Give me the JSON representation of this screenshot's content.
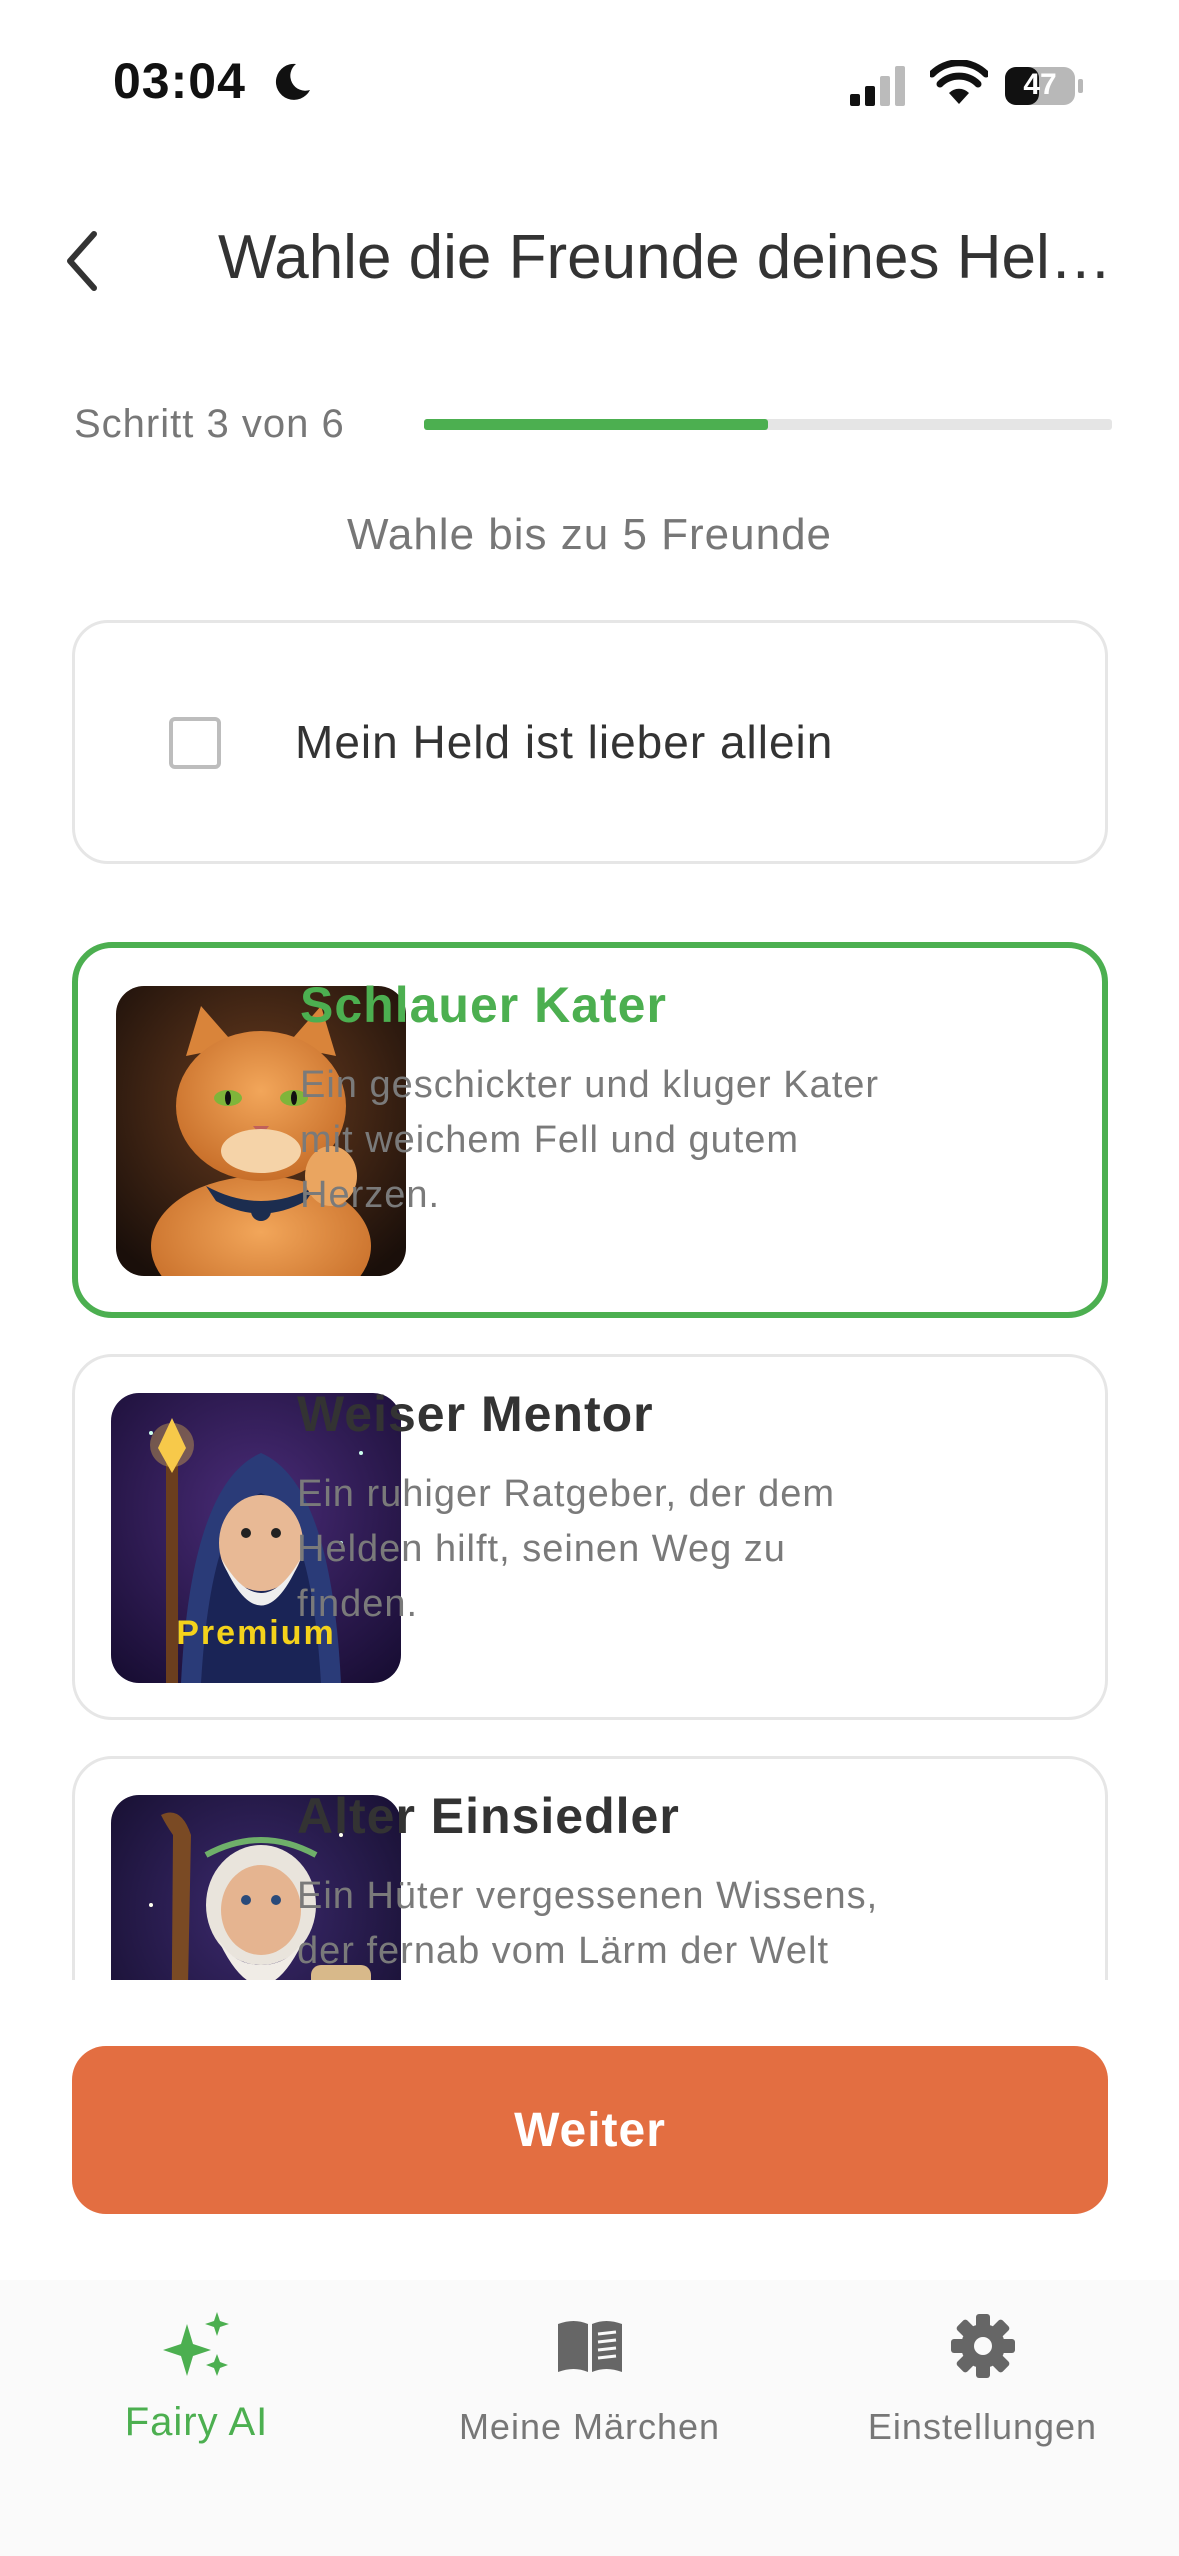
{
  "status_bar": {
    "time": "03:04",
    "battery": "47"
  },
  "header": {
    "title": "Wahle die Freunde deines Held..."
  },
  "progress": {
    "step_label": "Schritt 3 von 6",
    "current": 3,
    "total": 6,
    "fraction": 0.5
  },
  "subtitle": "Wahle bis zu 5 Freunde",
  "alone_option": {
    "label": "Mein Held ist lieber allein",
    "checked": false
  },
  "friends": [
    {
      "title": "Schlauer Kater",
      "desc_lines": [
        "Ein geschickter und kluger Kater",
        "mit weichem Fell und gutem",
        "Herzen."
      ],
      "selected": true,
      "badge": ""
    },
    {
      "title": "Weiser Mentor",
      "desc_lines": [
        "Ein ruhiger Ratgeber, der dem",
        "Helden hilft, seinen Weg zu",
        "finden."
      ],
      "selected": false,
      "badge": "Premium"
    },
    {
      "title": "Alter Einsiedler",
      "desc_lines": [
        "Ein Hüter vergessenen Wissens,",
        "der fernab vom Lärm der Welt"
      ],
      "selected": false,
      "badge": ""
    }
  ],
  "next_button": {
    "label": "Weiter"
  },
  "tabs": [
    {
      "label": "Fairy AI",
      "icon": "sparkles-icon",
      "active": true
    },
    {
      "label": "Meine Märchen",
      "icon": "book-icon",
      "active": false
    },
    {
      "label": "Einstellungen",
      "icon": "gear-icon",
      "active": false
    }
  ],
  "colors": {
    "accent_green": "#4caf50",
    "button_orange": "#e36e41",
    "premium_yellow": "#f4d21b"
  }
}
